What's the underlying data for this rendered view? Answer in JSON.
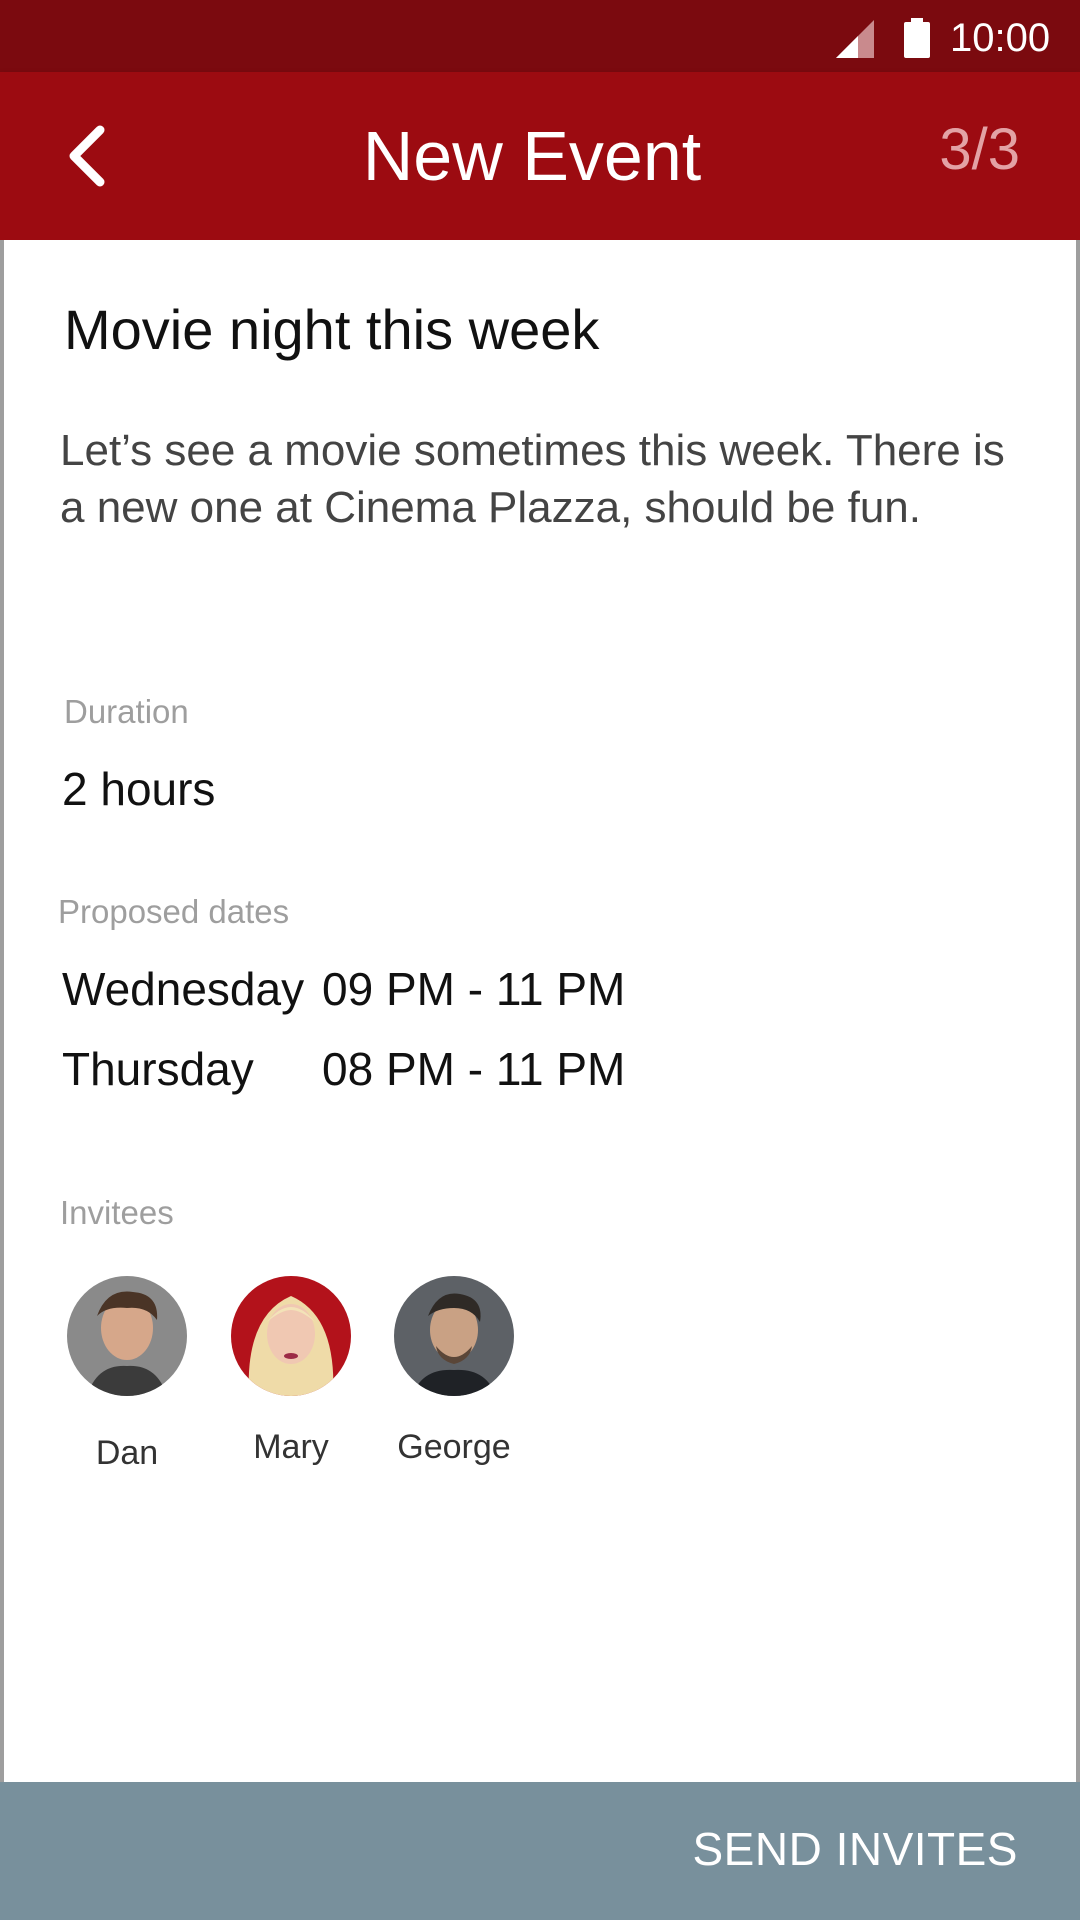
{
  "status_bar": {
    "time": "10:00",
    "icons": [
      "signal-icon",
      "battery-icon"
    ],
    "background": "#7b0a0f"
  },
  "app_bar": {
    "title": "New Event",
    "step": "3/3",
    "back_icon": "chevron-left-icon",
    "background": "#9c0b11"
  },
  "event": {
    "title": "Movie night this week",
    "description": "Let’s see a movie sometimes this week. There is a new one at Cinema Plazza, should be fun.",
    "duration_label": "Duration",
    "duration_value": "2 hours",
    "dates_label": "Proposed dates",
    "dates": [
      {
        "day": "Wednesday",
        "time": "09 PM - 11 PM"
      },
      {
        "day": "Thursday",
        "time": "08 PM - 11 PM"
      }
    ],
    "invitees_label": "Invitees",
    "invitees": [
      {
        "name": "Dan"
      },
      {
        "name": "Mary"
      },
      {
        "name": "George"
      }
    ]
  },
  "footer": {
    "send_label": "SEND INVITES",
    "background": "#78909c"
  }
}
